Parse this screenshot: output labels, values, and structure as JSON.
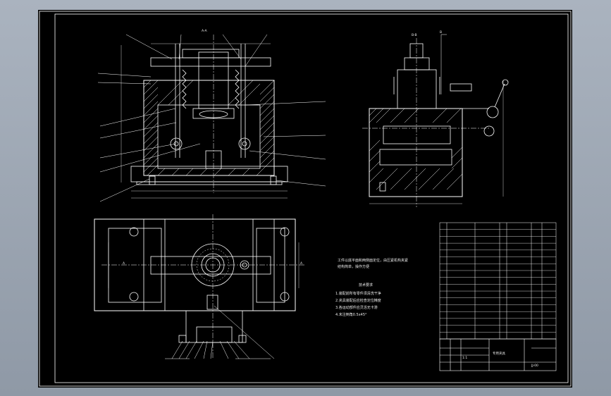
{
  "drawing": {
    "background_color": "#000000",
    "line_color": "#ffffff",
    "frame_color": "#ffffff"
  },
  "views": {
    "front_section_label": "A-A",
    "side_section_label": "B-B",
    "right_marker": "B",
    "plan_section_marker_left": "A",
    "plan_section_marker_right": "A"
  },
  "notes": {
    "title": "技术要求",
    "intro": "工件以底平面和两侧面定位，由压紧机构夹紧",
    "intro2": "结构简单，操作方便",
    "items": [
      "1.装配前所有零件须清洗干净",
      "2.夹具装配后应检查定位精度",
      "3.各运动部件应灵活无卡滞",
      "4.未注倒角0.5x45°"
    ]
  },
  "title_block": {
    "drawing_no": "JJ-00",
    "material": "",
    "scale": "1:1",
    "name": "专用夹具"
  },
  "parts_list": {
    "rows": 17
  }
}
